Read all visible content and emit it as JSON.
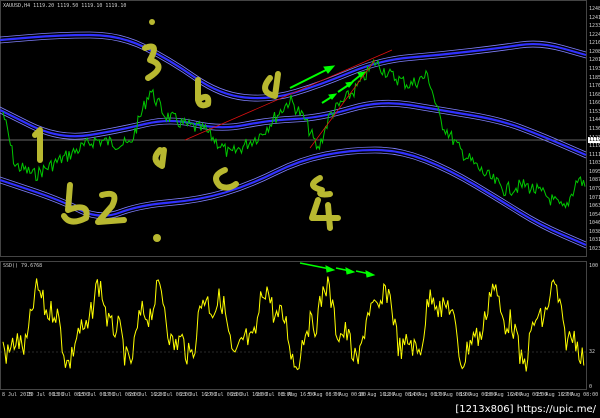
{
  "main_panel": {
    "symbol_header": "XAUUSD,H4  1119.20 1119.50 1119.10 1119.10",
    "price_axis": [
      "1248",
      "1241",
      "1233",
      "1224",
      "1216",
      "1208",
      "1201",
      "1193",
      "1185",
      "1176",
      "1168",
      "1160",
      "1153",
      "1144",
      "1136",
      "1127",
      "1119",
      "1111",
      "1103",
      "1095",
      "1087",
      "1079",
      "1071",
      "1063",
      "1054",
      "1046",
      "1038",
      "1031",
      "1023"
    ],
    "current_price": "1119",
    "annotations": [
      "1",
      "2",
      "3",
      "4",
      "a",
      "b",
      "c",
      "d",
      "e"
    ],
    "colors": {
      "price": "#00c800",
      "bands": "#3030ff",
      "band_edge": "#8080ff",
      "trendline": "#e01010",
      "arrow": "#00ff00",
      "marker": "#ffe000"
    }
  },
  "indicator_panel": {
    "header": "SSD() 79.6768",
    "axis": [
      "100",
      "32",
      "0"
    ],
    "color": "#ffff00"
  },
  "time_axis": [
    "8 Jul 2015",
    "10 Jul 00:00",
    "13 Jul 08:00",
    "15 Jul 00:00",
    "17 Jul 08:00",
    "20 Jul 16:00",
    "22 Jul 00:00",
    "23 Jul 16:00",
    "27 Jul 00:00",
    "28 Jul 16:00",
    "30 Jul 08:00",
    "3 Aug 16:00",
    "5 Aug 08:00",
    "7 Aug 00:00",
    "10 Aug 16:00",
    "12 Aug 08:00",
    "14 Aug 00:00",
    "17 Aug 08:00",
    "19 Aug 00:00",
    "20 Aug 16:00",
    "24 Aug 00:00",
    "25 Aug 16:00",
    "27 Aug 08:00"
  ],
  "watermark": "[1213x806] https://upic.me/"
}
